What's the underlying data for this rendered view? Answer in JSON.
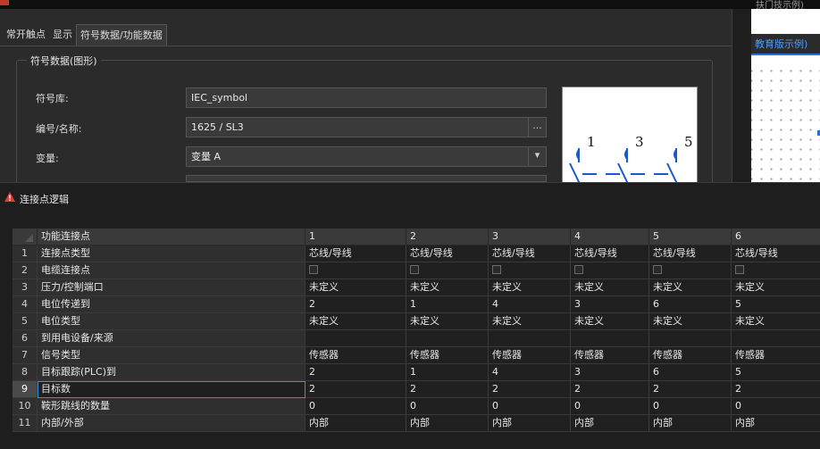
{
  "top_window": {
    "tabs": [
      "常开触点",
      "显示",
      "符号数据/功能数据"
    ],
    "group_title": "符号数据(图形)",
    "fields": [
      {
        "label": "符号库:",
        "value": "IEC_symbol"
      },
      {
        "label": "编号/名称:",
        "value": "1625 / SL3",
        "button": "..."
      },
      {
        "label": "变量:",
        "value": "变量 A",
        "button": "▾"
      }
    ],
    "right_panel_header": "教育版示例)",
    "right_panel_top_text": "扶门技示例)",
    "preview_labels": [
      "1",
      "3",
      "5"
    ]
  },
  "logic_window": {
    "title": "连接点逻辑",
    "header": {
      "name": "功能连接点",
      "columns": [
        "1",
        "2",
        "3",
        "4",
        "5",
        "6"
      ]
    },
    "rows": [
      {
        "idx": "1",
        "name": "连接点类型",
        "values": [
          "芯线/导线",
          "芯线/导线",
          "芯线/导线",
          "芯线/导线",
          "芯线/导线",
          "芯线/导线"
        ]
      },
      {
        "idx": "2",
        "name": "电缆连接点",
        "checkbox": true,
        "values": [
          "",
          "",
          "",
          "",
          "",
          ""
        ]
      },
      {
        "idx": "3",
        "name": "压力/控制端口",
        "values": [
          "未定义",
          "未定义",
          "未定义",
          "未定义",
          "未定义",
          "未定义"
        ]
      },
      {
        "idx": "4",
        "name": "电位传递到",
        "values": [
          "2",
          "1",
          "4",
          "3",
          "6",
          "5"
        ]
      },
      {
        "idx": "5",
        "name": "电位类型",
        "values": [
          "未定义",
          "未定义",
          "未定义",
          "未定义",
          "未定义",
          "未定义"
        ]
      },
      {
        "idx": "6",
        "name": "到用电设备/来源",
        "values": [
          "",
          "",
          "",
          "",
          "",
          ""
        ]
      },
      {
        "idx": "7",
        "name": "信号类型",
        "values": [
          "传感器",
          "传感器",
          "传感器",
          "传感器",
          "传感器",
          "传感器"
        ]
      },
      {
        "idx": "8",
        "name": "目标跟踪(PLC)到",
        "values": [
          "2",
          "1",
          "4",
          "3",
          "6",
          "5"
        ]
      },
      {
        "idx": "9",
        "name": "目标数",
        "selected": true,
        "values": [
          "2",
          "2",
          "2",
          "2",
          "2",
          "2"
        ]
      },
      {
        "idx": "10",
        "name": "鞍形跳线的数量",
        "values": [
          "0",
          "0",
          "0",
          "0",
          "0",
          "0"
        ]
      },
      {
        "idx": "11",
        "name": "内部/外部",
        "values": [
          "内部",
          "内部",
          "内部",
          "内部",
          "内部",
          "内部"
        ]
      }
    ]
  },
  "colors": {
    "accent": "#1a73e8",
    "warning": "#e53935",
    "selection": "#3e8ee0"
  }
}
